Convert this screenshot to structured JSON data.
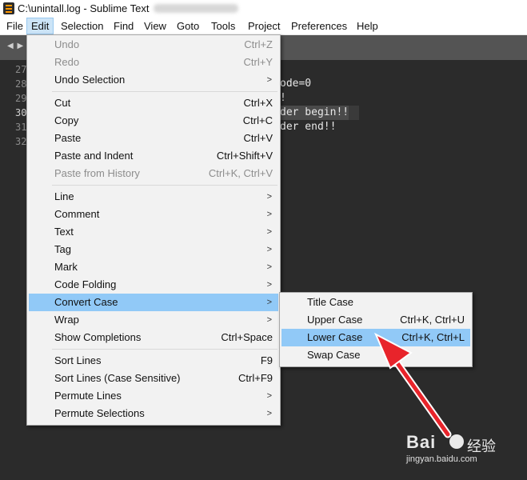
{
  "window": {
    "title": "C:\\unintall.log - Sublime Text"
  },
  "menubar": [
    "File",
    "Edit",
    "Selection",
    "Find",
    "View",
    "Goto",
    "Tools",
    "Project",
    "Preferences",
    "Help"
  ],
  "editor": {
    "line_numbers": [
      "27",
      "28",
      "29",
      "30",
      "31",
      "32"
    ],
    "code_lines": [
      "ode=0",
      "!",
      "der begin!!",
      "der end!!"
    ]
  },
  "edit_menu": {
    "undo": {
      "label": "Undo",
      "shortcut": "Ctrl+Z"
    },
    "redo": {
      "label": "Redo",
      "shortcut": "Ctrl+Y"
    },
    "undo_selection": {
      "label": "Undo Selection"
    },
    "cut": {
      "label": "Cut",
      "shortcut": "Ctrl+X"
    },
    "copy": {
      "label": "Copy",
      "shortcut": "Ctrl+C"
    },
    "paste": {
      "label": "Paste",
      "shortcut": "Ctrl+V"
    },
    "paste_indent": {
      "label": "Paste and Indent",
      "shortcut": "Ctrl+Shift+V"
    },
    "paste_history": {
      "label": "Paste from History",
      "shortcut": "Ctrl+K, Ctrl+V"
    },
    "line": {
      "label": "Line"
    },
    "comment": {
      "label": "Comment"
    },
    "text": {
      "label": "Text"
    },
    "tag": {
      "label": "Tag"
    },
    "mark": {
      "label": "Mark"
    },
    "code_folding": {
      "label": "Code Folding"
    },
    "convert_case": {
      "label": "Convert Case"
    },
    "wrap": {
      "label": "Wrap"
    },
    "show_completions": {
      "label": "Show Completions",
      "shortcut": "Ctrl+Space"
    },
    "sort_lines": {
      "label": "Sort Lines",
      "shortcut": "F9"
    },
    "sort_lines_cs": {
      "label": "Sort Lines (Case Sensitive)",
      "shortcut": "Ctrl+F9"
    },
    "permute_lines": {
      "label": "Permute Lines"
    },
    "permute_selections": {
      "label": "Permute Selections"
    }
  },
  "convert_case_submenu": {
    "title_case": {
      "label": "Title Case"
    },
    "upper_case": {
      "label": "Upper Case",
      "shortcut": "Ctrl+K, Ctrl+U"
    },
    "lower_case": {
      "label": "Lower Case",
      "shortcut": "Ctrl+K, Ctrl+L"
    },
    "swap_case": {
      "label": "Swap Case"
    }
  },
  "watermark": {
    "logo": "Bai",
    "brand": "经验",
    "url": "jingyan.baidu.com"
  },
  "colors": {
    "highlight": "#91c9f7",
    "arrow": "#e8242b",
    "editor_bg": "#2b2b2b"
  }
}
